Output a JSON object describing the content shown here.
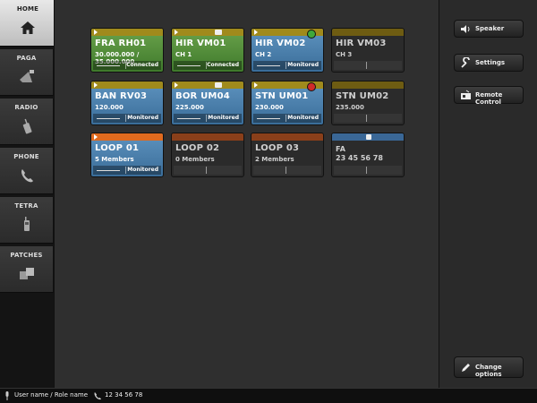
{
  "nav": {
    "items": [
      {
        "label": "HOME",
        "icon": "home-icon",
        "active": true
      },
      {
        "label": "PAGA",
        "icon": "megaphone-icon",
        "active": false
      },
      {
        "label": "RADIO",
        "icon": "radio-icon",
        "active": false
      },
      {
        "label": "PHONE",
        "icon": "phone-icon",
        "active": false
      },
      {
        "label": "TETRA",
        "icon": "handset-icon",
        "active": false
      },
      {
        "label": "PATCHES",
        "icon": "patches-icon",
        "active": false
      }
    ]
  },
  "tiles": [
    {
      "name": "FRA RH01",
      "sub": "30.000.000 / 35.000.000",
      "status": "Connected",
      "color": "green"
    },
    {
      "name": "HIR VM01",
      "sub": "CH 1",
      "status": "Connected",
      "color": "green"
    },
    {
      "name": "HIR VM02",
      "sub": "CH 2",
      "status": "Monitored",
      "color": "blue",
      "badge": "green"
    },
    {
      "name": "HIR VM03",
      "sub": "CH 3",
      "status": "",
      "color": "dark"
    },
    {
      "name": "BAN RV03",
      "sub": "120.000",
      "status": "Monitored",
      "color": "blue"
    },
    {
      "name": "BOR UM04",
      "sub": "225.000",
      "status": "Monitored",
      "color": "blue"
    },
    {
      "name": "STN UM01",
      "sub": "230.000",
      "status": "Monitored",
      "color": "blue",
      "badge": "red"
    },
    {
      "name": "STN UM02",
      "sub": "235.000",
      "status": "",
      "color": "dark"
    },
    {
      "name": "LOOP 01",
      "sub": "5 Members",
      "status": "Monitored",
      "color": "loop-active"
    },
    {
      "name": "LOOP 02",
      "sub": "0 Members",
      "status": "",
      "color": "loop"
    },
    {
      "name": "LOOP 03",
      "sub": "2 Members",
      "status": "",
      "color": "loop"
    },
    {
      "name": "FA",
      "sub": "23 45 56 78",
      "status": "",
      "color": "phone"
    }
  ],
  "right": {
    "buttons": [
      {
        "label": "Speaker",
        "icon": "speaker-icon"
      },
      {
        "label": "Settings",
        "icon": "wrench-icon"
      },
      {
        "label": "Remote Control",
        "icon": "remote-control-icon"
      }
    ],
    "change_options": "Change options"
  },
  "footer": {
    "user": "User name / Role name",
    "phone": "12 34 56 78"
  },
  "colors": {
    "green_strip": "#a08a1c",
    "orange_strip": "#e06a1e",
    "brown_strip": "#8a3f1a",
    "blue_strip": "#3a6796"
  }
}
